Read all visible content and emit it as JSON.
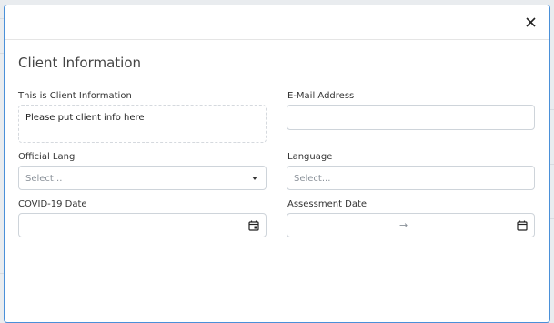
{
  "modal": {
    "close_icon": "close-icon",
    "section_title": "Client Information"
  },
  "form": {
    "client_info": {
      "label": "This is Client Information",
      "value": "Please put client info here"
    },
    "email": {
      "label": "E-Mail Address",
      "value": ""
    },
    "official_lang": {
      "label": "Official Lang",
      "placeholder": "Select..."
    },
    "language": {
      "label": "Language",
      "placeholder": "Select..."
    },
    "covid_date": {
      "label": "COVID-19 Date",
      "icon": "calendar-icon"
    },
    "assessment_date": {
      "label": "Assessment Date",
      "separator": "→",
      "icon": "calendar-icon"
    }
  },
  "colors": {
    "modal_border": "#4a90d9",
    "input_border": "#ced4da",
    "placeholder": "#8a9199"
  }
}
